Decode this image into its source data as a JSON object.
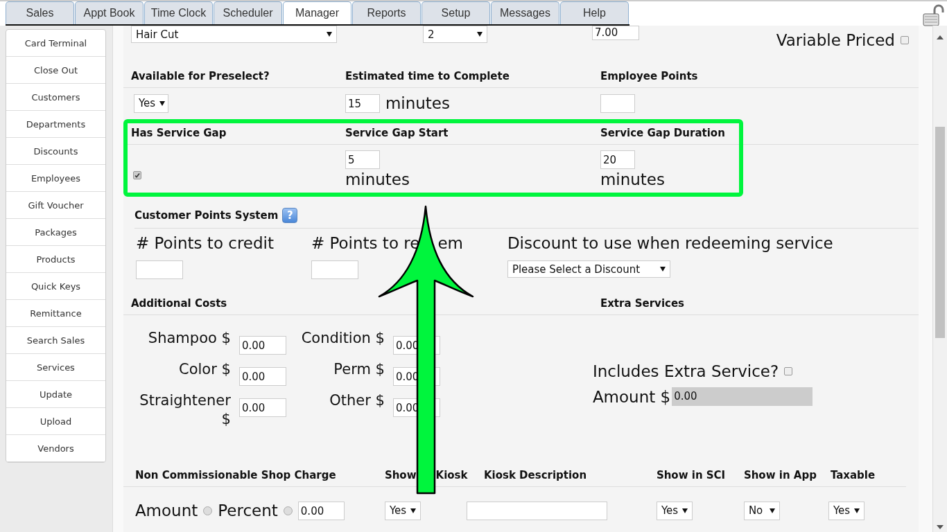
{
  "tabs": [
    {
      "label": "Sales",
      "selected": false
    },
    {
      "label": "Appt Book",
      "selected": false
    },
    {
      "label": "Time Clock",
      "selected": false
    },
    {
      "label": "Scheduler",
      "selected": false
    },
    {
      "label": "Manager",
      "selected": true
    },
    {
      "label": "Reports",
      "selected": false
    },
    {
      "label": "Setup",
      "selected": false
    },
    {
      "label": "Messages",
      "selected": false
    },
    {
      "label": "Help",
      "selected": false
    }
  ],
  "sidebar": {
    "items": [
      {
        "label": "Card Terminal"
      },
      {
        "label": "Close Out"
      },
      {
        "label": "Customers"
      },
      {
        "label": "Departments"
      },
      {
        "label": "Discounts"
      },
      {
        "label": "Employees"
      },
      {
        "label": "Gift Voucher"
      },
      {
        "label": "Packages"
      },
      {
        "label": "Products"
      },
      {
        "label": "Quick Keys"
      },
      {
        "label": "Remittance"
      },
      {
        "label": "Search Sales"
      },
      {
        "label": "Services"
      },
      {
        "label": "Update"
      },
      {
        "label": "Upload"
      },
      {
        "label": "Vendors"
      }
    ]
  },
  "service": {
    "name_select": "Hair Cut",
    "quantity_select": "2",
    "price": "7.00",
    "variable_priced_label": "Variable Priced",
    "variable_priced": false
  },
  "options": {
    "columns": [
      "Available for Preselect?",
      "Estimated time to Complete",
      "Employee Points"
    ],
    "preselect": "Yes",
    "estimated_time": "15",
    "estimated_unit": "minutes"
  },
  "service_gap": {
    "columns": [
      "Has Service Gap",
      "Service Gap Start",
      "Service Gap Duration"
    ],
    "has_gap": true,
    "start": "5",
    "start_unit": "minutes",
    "duration": "20",
    "duration_unit": "minutes"
  },
  "customer_points": {
    "title": "Customer Points System",
    "help": "?",
    "fields": [
      {
        "parts": [
          "# Points to credit"
        ]
      },
      {
        "parts": [
          "# Points to re",
          "em"
        ]
      },
      {
        "parts": [
          "Discount to use when redeeming service"
        ]
      }
    ],
    "discount_select": "Please Select a Discount"
  },
  "additional_costs": {
    "title": "Additional Costs",
    "items": [
      {
        "label": "Shampoo $",
        "value": "0.00"
      },
      {
        "label": "Condition $",
        "value": "0.00"
      },
      {
        "label": "Color $",
        "value": "0.00"
      },
      {
        "label": "Perm $",
        "value": "0.00"
      },
      {
        "label": "Straightener $",
        "value": "0.00"
      },
      {
        "label": "Other $",
        "value": "0.00"
      }
    ]
  },
  "extra_services": {
    "title": "Extra Services",
    "includes_label": "Includes Extra Service?",
    "includes": false,
    "amount_label": "Amount $",
    "amount": "0.00"
  },
  "shop_charge": {
    "columns": [
      {
        "parts": [
          "Non Commissionable Shop Charge"
        ]
      },
      {
        "parts": [
          "Show",
          "Kiosk"
        ]
      },
      {
        "parts": [
          "Kiosk Description"
        ]
      },
      {
        "parts": [
          "Show in SCI"
        ]
      },
      {
        "parts": [
          "Show in App"
        ]
      },
      {
        "parts": [
          "Taxable"
        ]
      }
    ],
    "amount_label": "Amount",
    "amount_selected": false,
    "percent_label": "Percent",
    "percent_selected": false,
    "value": "0.00",
    "show_in_kiosk": "Yes",
    "show_in_sci": "Yes",
    "show_in_app": "No",
    "taxable": "Yes"
  }
}
